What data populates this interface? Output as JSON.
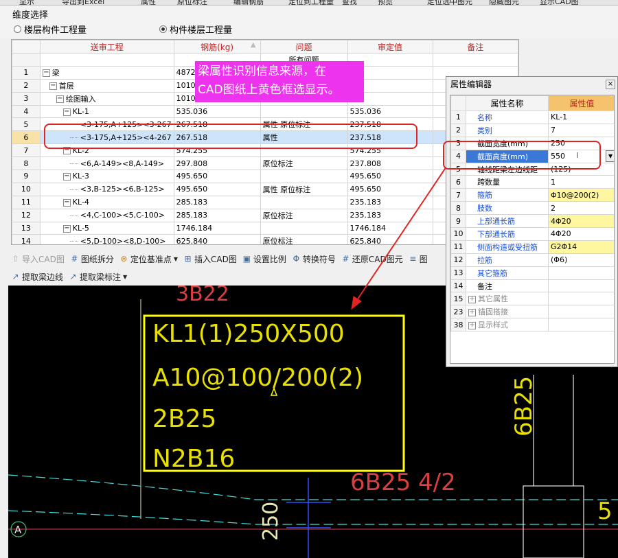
{
  "topbar": {
    "items": [
      "显示",
      "导出到Excel",
      "属性",
      "原位标注",
      "编辑钢筋",
      "定位到工程量",
      "查找",
      "预览",
      "定位选中图元",
      "隐藏图元",
      "显示CAD图"
    ]
  },
  "dimension": {
    "label": "维度选择",
    "option1": "楼层构件工程量",
    "option2": "构件楼层工程量",
    "selected": "option2"
  },
  "grid": {
    "headers": [
      "",
      "送审工程",
      "钢筋(kg)",
      "问题",
      "审定值",
      "备注"
    ],
    "filter_text": "所有问题",
    "rows": [
      {
        "n": "1",
        "indent": 0,
        "toggle": "minus",
        "name": "梁",
        "steel": "48720.3",
        "issue": "",
        "value": "358"
      },
      {
        "n": "2",
        "indent": 1,
        "toggle": "minus",
        "name": "首层",
        "steel": "10108.6",
        "issue": "",
        "value": "617"
      },
      {
        "n": "3",
        "indent": 2,
        "toggle": "minus",
        "name": "绘图输入",
        "steel": "10108.6",
        "issue": "",
        "value": "617"
      },
      {
        "n": "4",
        "indent": 3,
        "toggle": "minus",
        "name": "KL-1",
        "steel": "535.036",
        "issue": "",
        "value": "535.036"
      },
      {
        "n": "5",
        "indent": 4,
        "toggle": "",
        "name": "<3-175,A+125><3-267",
        "steel": "267.518",
        "issue": "属性  原位标注",
        "value": "237.518"
      },
      {
        "n": "6",
        "indent": 4,
        "toggle": "",
        "name": "<3-175,A+125><4-267",
        "steel": "267.518",
        "issue": "属性",
        "value": "237.518",
        "selected": true
      },
      {
        "n": "7",
        "indent": 3,
        "toggle": "minus",
        "name": "KL-2",
        "steel": "574.255",
        "issue": "",
        "value": "574.255"
      },
      {
        "n": "8",
        "indent": 4,
        "toggle": "",
        "name": "<6,A-149><8,A-149>",
        "steel": "297.808",
        "issue": "原位标注",
        "value": "237.808"
      },
      {
        "n": "9",
        "indent": 3,
        "toggle": "minus",
        "name": "KL-3",
        "steel": "495.650",
        "issue": "",
        "value": "495.650"
      },
      {
        "n": "10",
        "indent": 4,
        "toggle": "",
        "name": "<3,B-125><6,B-125>",
        "steel": "495.650",
        "issue": "属性  原位标注",
        "value": "495.650"
      },
      {
        "n": "11",
        "indent": 3,
        "toggle": "minus",
        "name": "KL-4",
        "steel": "285.183",
        "issue": "",
        "value": "235.183"
      },
      {
        "n": "12",
        "indent": 4,
        "toggle": "",
        "name": "<4,C-100><5,C-100>",
        "steel": "285.183",
        "issue": "原位标注",
        "value": "235.183"
      },
      {
        "n": "13",
        "indent": 3,
        "toggle": "minus",
        "name": "KL-5",
        "steel": "1746.184",
        "issue": "",
        "value": "1746.184"
      },
      {
        "n": "14",
        "indent": 4,
        "toggle": "",
        "name": "<5,D-100><8,D-100>",
        "steel": "625.840",
        "issue": "原位标注",
        "value": "625.840"
      }
    ]
  },
  "callout": {
    "line1": "梁属性识别信息来源，在",
    "line2": "CAD图纸上黄色框选显示。"
  },
  "toolbar1": {
    "import_cad": "导入CAD图",
    "split": "图纸拆分",
    "locate": "定位基准点",
    "insert": "插入CAD图",
    "scale": "设置比例",
    "convert": "转换符号",
    "restore": "还原CAD图元",
    "more": "图"
  },
  "toolbar2": {
    "extract_edge": "提取梁边线",
    "extract_label": "提取梁标注"
  },
  "cad": {
    "label_top": "3B22",
    "box_line1": "KL1(1)250X500",
    "box_line2": "A10@100/200(2)",
    "box_line3": "2B25",
    "box_line4": "N2B16",
    "label_red": "6B25 4/2",
    "label_vert": "250",
    "label_right_vert": "6B25",
    "axis_label": "A",
    "edge_label": "5"
  },
  "props": {
    "title": "属性编辑器",
    "close": "×",
    "col_name": "属性名称",
    "col_value": "属性值",
    "rows": [
      {
        "n": "1",
        "name": "名称",
        "value": "KL-1",
        "style": "blue"
      },
      {
        "n": "2",
        "name": "类别",
        "value": "7",
        "style": "blue"
      },
      {
        "n": "3",
        "name": "截面宽度(mm)",
        "value": "250",
        "style": ""
      },
      {
        "n": "4",
        "name": "截面高度(mm)",
        "value": "550",
        "style": "sel"
      },
      {
        "n": "5",
        "name": "轴线距梁左边线距",
        "value": "(125)",
        "style": ""
      },
      {
        "n": "6",
        "name": "跨数量",
        "value": "1",
        "style": ""
      },
      {
        "n": "7",
        "name": "箍筋",
        "value": "Φ10@200(2)",
        "style": "blue-hl"
      },
      {
        "n": "8",
        "name": "肢数",
        "value": "2",
        "style": "blue"
      },
      {
        "n": "9",
        "name": "上部通长筋",
        "value": "4Φ20",
        "style": "blue-hl"
      },
      {
        "n": "10",
        "name": "下部通长筋",
        "value": "4Φ20",
        "style": "blue"
      },
      {
        "n": "11",
        "name": "侧面构造或受扭筋",
        "value": "G2Φ14",
        "style": "blue-hl"
      },
      {
        "n": "12",
        "name": "拉筋",
        "value": "(Φ6)",
        "style": "blue"
      },
      {
        "n": "13",
        "name": "其它箍筋",
        "value": "",
        "style": "blue"
      },
      {
        "n": "14",
        "name": "备注",
        "value": "",
        "style": ""
      },
      {
        "n": "15",
        "name": "其它属性",
        "value": "",
        "style": "group"
      },
      {
        "n": "23",
        "name": "锚固搭接",
        "value": "",
        "style": "group"
      },
      {
        "n": "38",
        "name": "显示样式",
        "value": "",
        "style": "group"
      }
    ]
  },
  "colors": {
    "callout": "#ee33ee",
    "highlight_box": "#e02424",
    "cad_yellow": "#ffff00",
    "cad_red": "#d84040",
    "cad_cyan": "#40e0e0"
  }
}
